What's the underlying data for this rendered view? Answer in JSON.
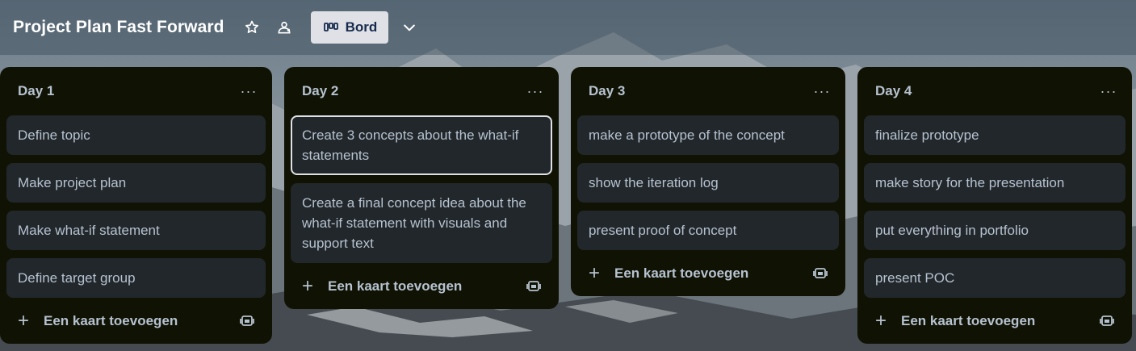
{
  "board": {
    "title": "Project Plan Fast Forward",
    "view_label": "Bord"
  },
  "icons": {
    "star": "star-icon",
    "visibility": "team-visibility-icon",
    "board_view": "board-view-icon",
    "chevron": "chevron-down-icon",
    "list_menu": "more-icon",
    "add": "plus-icon",
    "template": "card-template-icon"
  },
  "lists": [
    {
      "title": "Day 1",
      "cards": [
        "Define topic",
        "Make project plan",
        "Make what-if statement",
        "Define target group"
      ],
      "add_label": "Een kaart toevoegen"
    },
    {
      "title": "Day 2",
      "cards": [
        "Create 3 concepts about the what-if statements",
        "Create a final concept idea about the what-if statement with visuals and support text"
      ],
      "add_label": "Een kaart toevoegen"
    },
    {
      "title": "Day 3",
      "cards": [
        "make a prototype of the concept",
        "show the iteration log",
        "present proof of concept"
      ],
      "add_label": "Een kaart toevoegen"
    },
    {
      "title": "Day 4",
      "cards": [
        "finalize prototype",
        "make story for the presentation",
        "put everything in portfolio",
        "present POC"
      ],
      "add_label": "Een kaart toevoegen"
    }
  ],
  "menu_glyph": "···",
  "colors": {
    "list_bg": "#101204",
    "card_bg": "#22272b",
    "text": "#b6c2cf",
    "view_button_bg": "#dfe1e6"
  }
}
